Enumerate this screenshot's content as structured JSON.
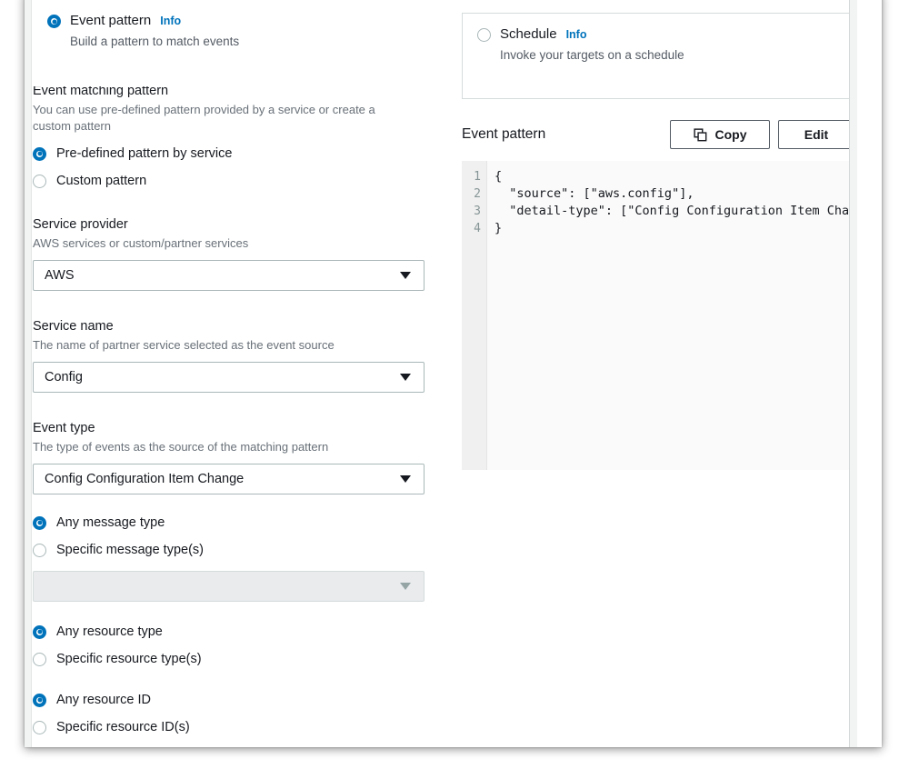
{
  "event_source": {
    "options": [
      {
        "id": "event-pattern",
        "title": "Event pattern",
        "info_label": "Info",
        "description": "Build a pattern to match events",
        "selected": true
      },
      {
        "id": "schedule",
        "title": "Schedule",
        "info_label": "Info",
        "description": "Invoke your targets on a schedule",
        "selected": false
      }
    ]
  },
  "matching": {
    "label": "Event matching pattern",
    "description": "You can use pre-defined pattern provided by a service or create a custom pattern",
    "options": [
      {
        "label": "Pre-defined pattern by service",
        "selected": true
      },
      {
        "label": "Custom pattern",
        "selected": false
      }
    ]
  },
  "service_provider": {
    "label": "Service provider",
    "description": "AWS services or custom/partner services",
    "value": "AWS"
  },
  "service_name": {
    "label": "Service name",
    "description": "The name of partner service selected as the event source",
    "value": "Config"
  },
  "event_type": {
    "label": "Event type",
    "description": "The type of events as the source of the matching pattern",
    "value": "Config Configuration Item Change"
  },
  "message_type": {
    "options": [
      {
        "label": "Any message type",
        "selected": true
      },
      {
        "label": "Specific message type(s)",
        "selected": false
      }
    ],
    "select_value": "",
    "select_disabled": true
  },
  "resource_type": {
    "options": [
      {
        "label": "Any resource type",
        "selected": true
      },
      {
        "label": "Specific resource type(s)",
        "selected": false
      }
    ]
  },
  "resource_id": {
    "options": [
      {
        "label": "Any resource ID",
        "selected": true
      },
      {
        "label": "Specific resource ID(s)",
        "selected": false
      }
    ]
  },
  "event_pattern_panel": {
    "title": "Event pattern",
    "copy_label": "Copy",
    "edit_label": "Edit",
    "line_numbers": [
      "1",
      "2",
      "3",
      "4"
    ],
    "code": "{\n  \"source\": [\"aws.config\"],\n  \"detail-type\": [\"Config Configuration Item Change\"]\n}"
  },
  "colors": {
    "accent": "#0073bb",
    "text": "#16191f",
    "muted": "#545b64",
    "border": "#aab7b8",
    "card_border": "#d5dbdb",
    "disabled_bg": "#e9ebed",
    "code_bg": "#fafafa",
    "gutter_bg": "#f0f0f0"
  }
}
